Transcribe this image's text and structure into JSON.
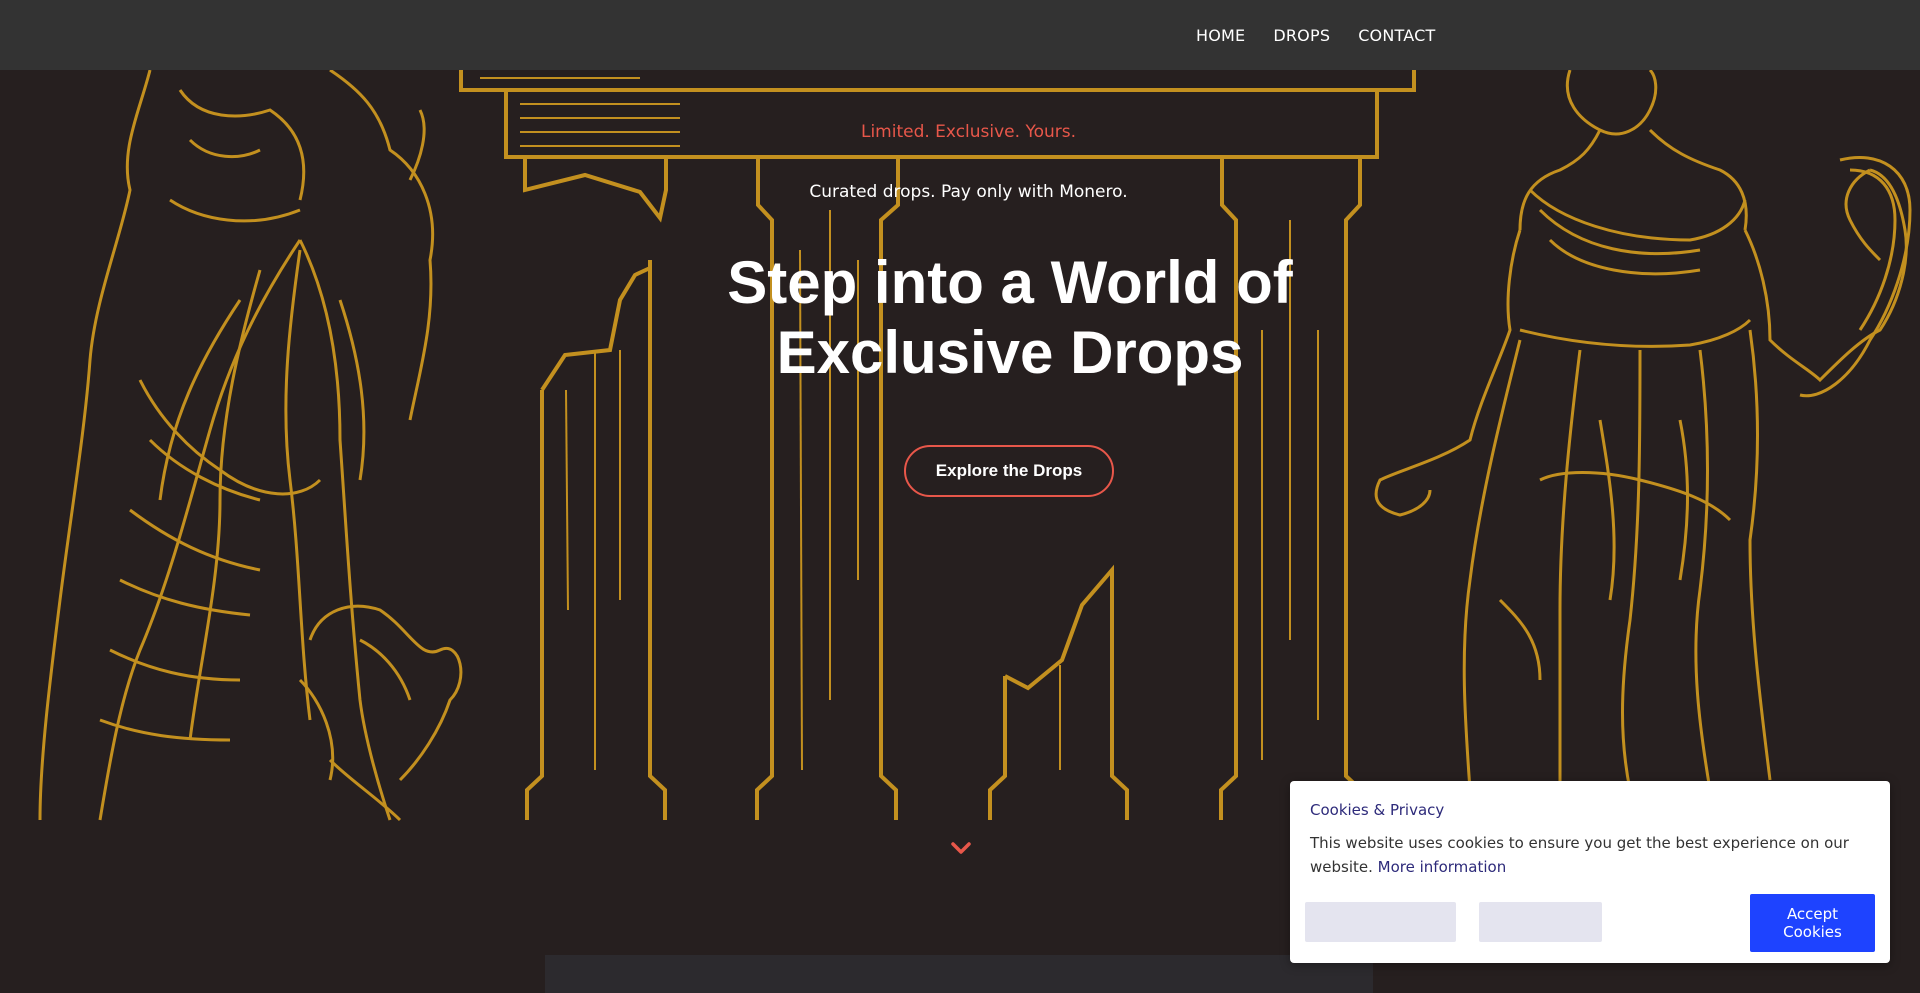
{
  "nav": {
    "items": [
      {
        "label": "HOME"
      },
      {
        "label": "DROPS"
      },
      {
        "label": "CONTACT"
      }
    ]
  },
  "hero": {
    "tagline": "Limited. Exclusive. Yours.",
    "subline": "Curated drops. Pay only with Monero.",
    "headline": "Step into a World of Exclusive Drops",
    "cta_label": "Explore the Drops",
    "scroll_icon": "chevron-down-icon"
  },
  "cookie_banner": {
    "title": "Cookies & Privacy",
    "text": "This website uses cookies to ensure you get the best experience on our website.",
    "link_label": "More information",
    "accept_label": "Accept Cookies"
  },
  "colors": {
    "background": "#261f1f",
    "nav_bg": "#333333",
    "gold": "#c3901f",
    "accent": "#e8574a",
    "cookie_accent": "#1e43ff",
    "cookie_title": "#2d2a7a"
  }
}
